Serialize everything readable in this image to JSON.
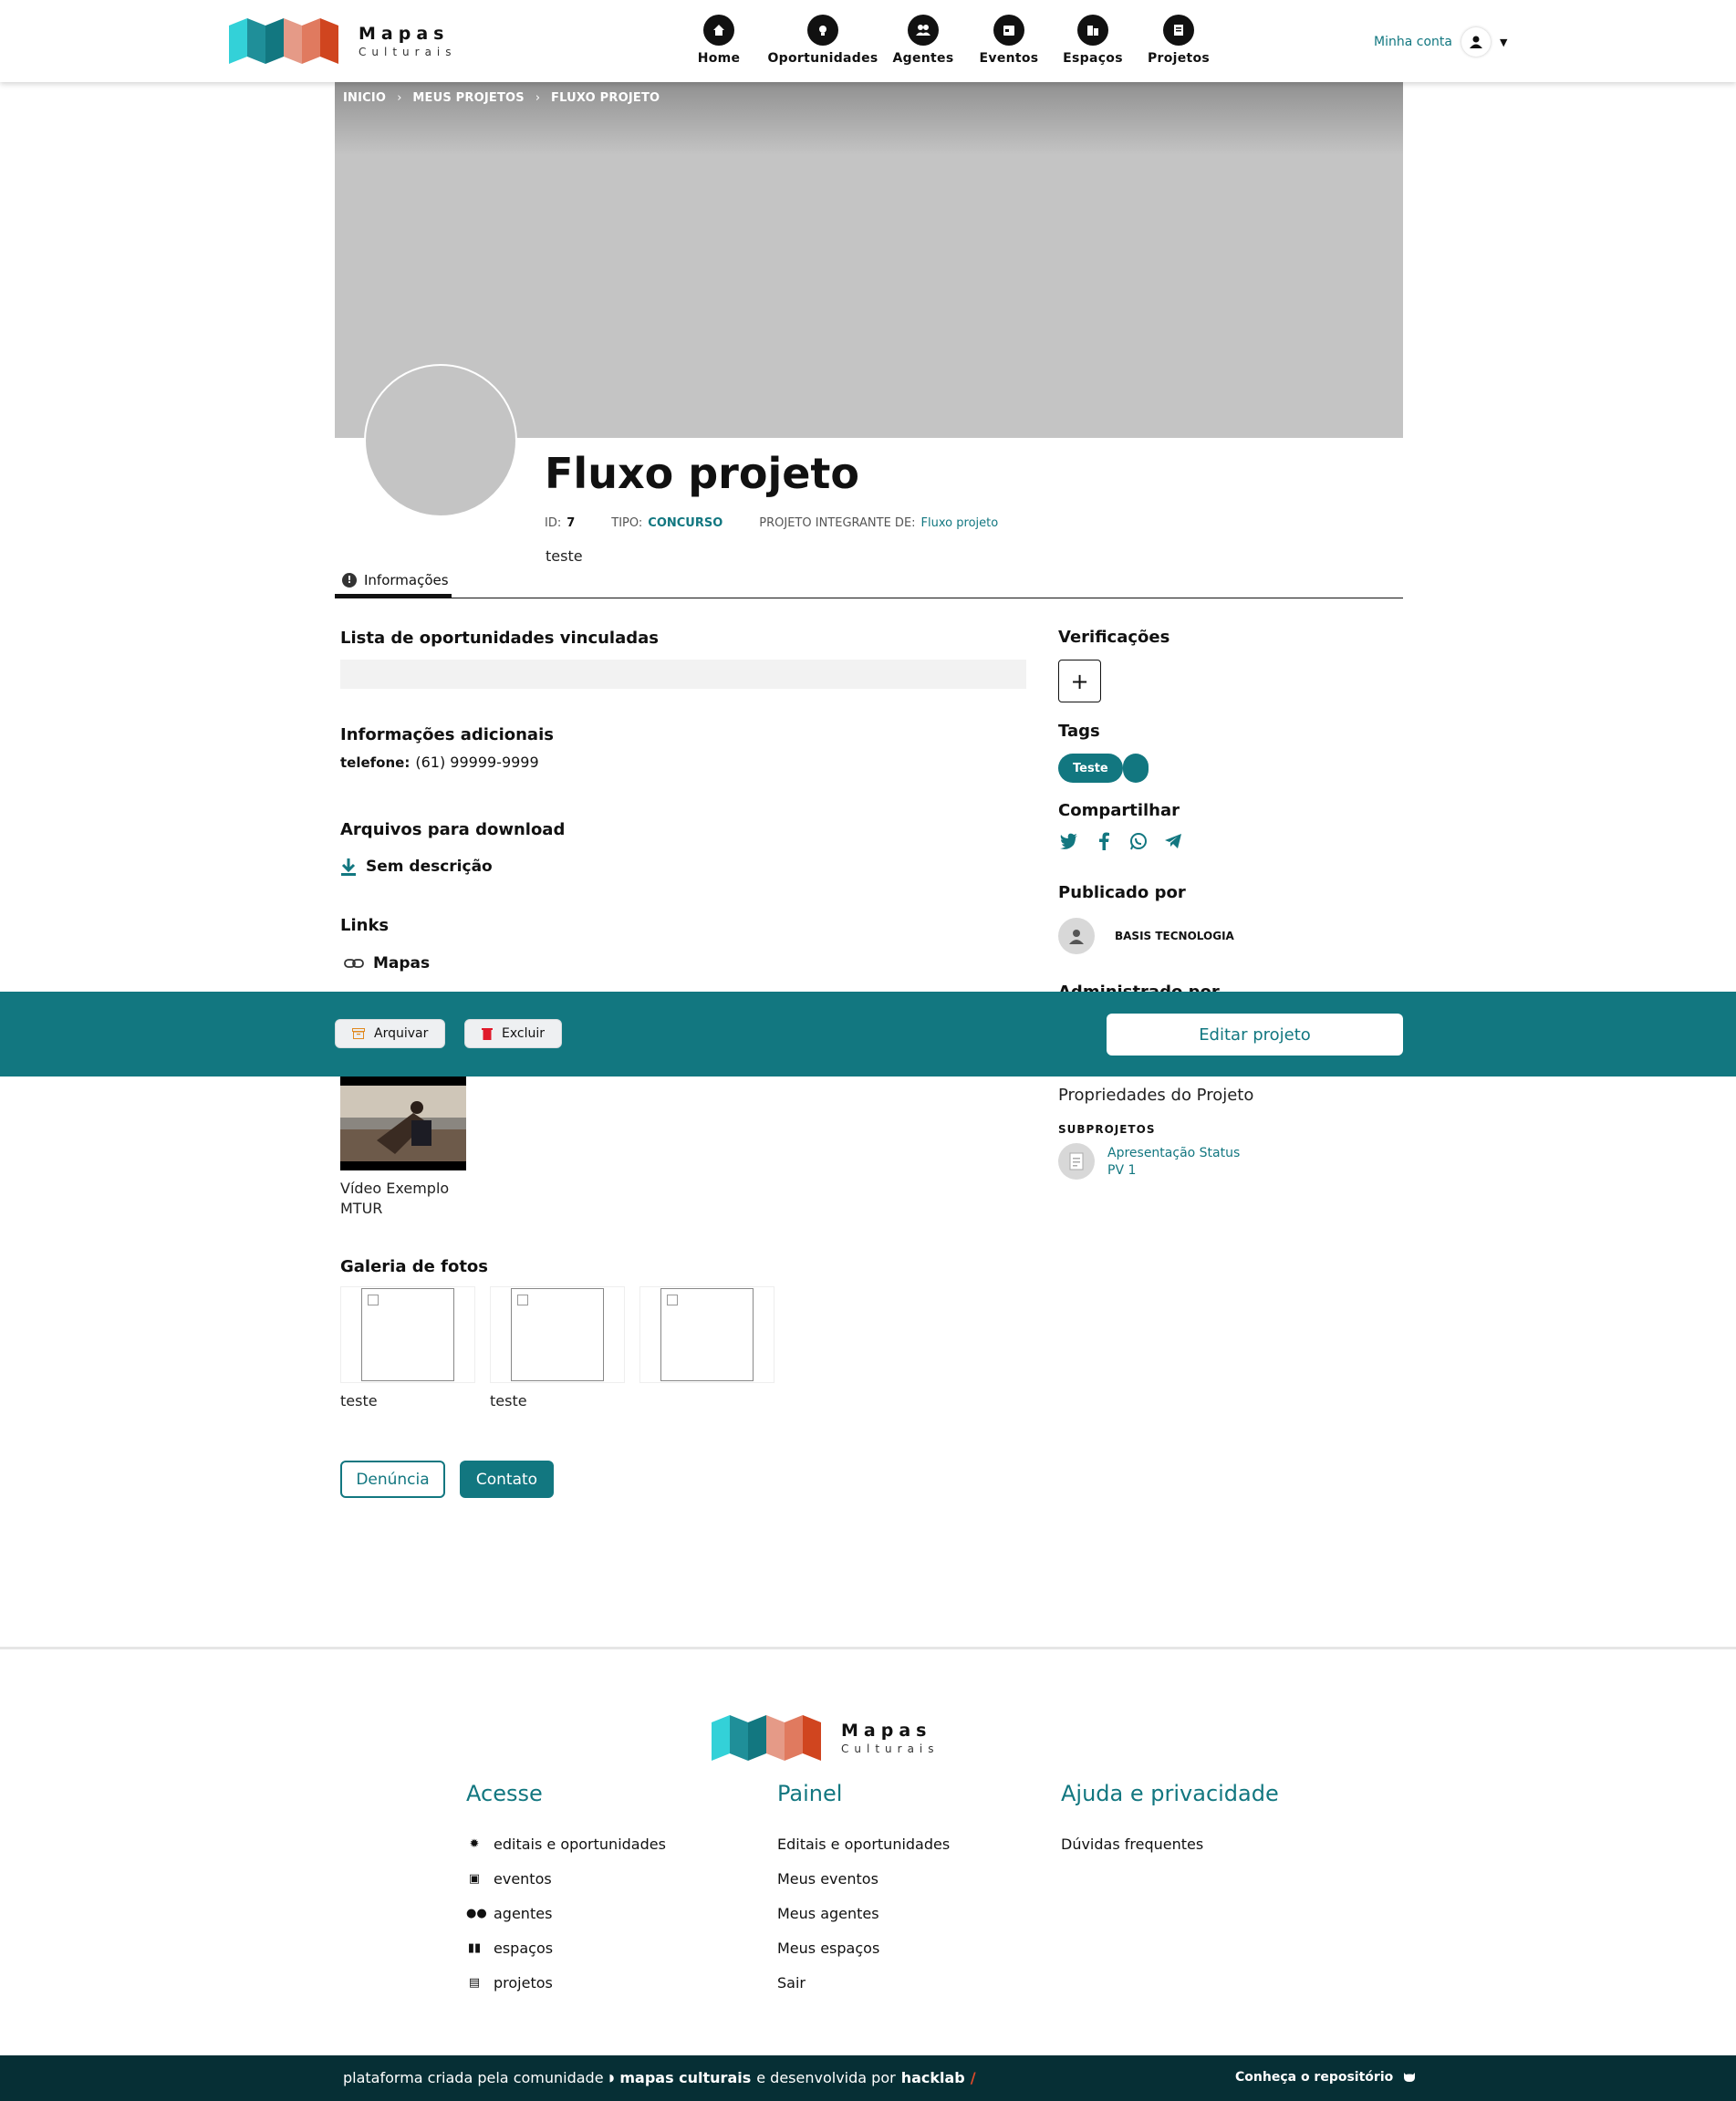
{
  "brand": {
    "title": "Mapas",
    "subtitle": "Culturais"
  },
  "nav": [
    {
      "label": "Home",
      "icon": "home-icon"
    },
    {
      "label": "Oportunidades",
      "icon": "lightbulb-icon"
    },
    {
      "label": "Agentes",
      "icon": "people-icon"
    },
    {
      "label": "Eventos",
      "icon": "calendar-icon"
    },
    {
      "label": "Espaços",
      "icon": "building-icon"
    },
    {
      "label": "Projetos",
      "icon": "document-icon"
    }
  ],
  "account": {
    "label": "Minha conta"
  },
  "breadcrumb": [
    "INICIO",
    "MEUS PROJETOS",
    "FLUXO PROJETO"
  ],
  "entity": {
    "title": "Fluxo projeto",
    "id_label": "ID:",
    "id": "7",
    "type_label": "TIPO:",
    "type": "CONCURSO",
    "parent_label": "PROJETO INTEGRANTE DE:",
    "parent": "Fluxo projeto",
    "short_description": "teste"
  },
  "tabs": [
    {
      "label": "Informações"
    }
  ],
  "sections": {
    "opportunities": "Lista de oportunidades vinculadas",
    "additional": "Informações adicionais",
    "phone_label": "telefone:",
    "phone": "(61) 99999-9999",
    "downloads": "Arquivos para download",
    "download_item": "Sem descrição",
    "links": "Links",
    "link_item": "Mapas",
    "video_caption": "Vídeo Exemplo MTUR",
    "gallery": "Galeria de fotos",
    "gallery_items": [
      "teste",
      "teste",
      ""
    ]
  },
  "actions": {
    "archive": "Arquivar",
    "delete": "Excluir",
    "edit": "Editar projeto",
    "report": "Denúncia",
    "contact": "Contato"
  },
  "sidebar": {
    "verifications": "Verificações",
    "add": "+",
    "tags": "Tags",
    "tag_items": [
      "Teste"
    ],
    "share": "Compartilhar",
    "published_by": "Publicado por",
    "publisher": "BASIS TECNOLOGIA",
    "admin_peek": "Administrado por",
    "properties": "Propriedades do Projeto",
    "subprojects_heading": "SUBPROJETOS",
    "subproject": "Apresentação Status PV 1"
  },
  "footer": {
    "col1_title": "Acesse",
    "col1": [
      "editais e oportunidades",
      "eventos",
      "agentes",
      "espaços",
      "projetos"
    ],
    "col2_title": "Painel",
    "col2": [
      "Editais e oportunidades",
      "Meus eventos",
      "Meus agentes",
      "Meus espaços",
      "Sair"
    ],
    "col3_title": "Ajuda e privacidade",
    "col3": [
      "Dúvidas frequentes"
    ],
    "bottom_prefix": "plataforma criada pela comunidade",
    "bottom_community": "mapas culturais",
    "bottom_middle": "e desenvolvida por",
    "bottom_dev": "hacklab",
    "bottom_slash": "/",
    "repo": "Conheça o repositório"
  },
  "colors": {
    "primary": "#127780",
    "dark": "#062f35",
    "cover": "#c4c4c4"
  }
}
